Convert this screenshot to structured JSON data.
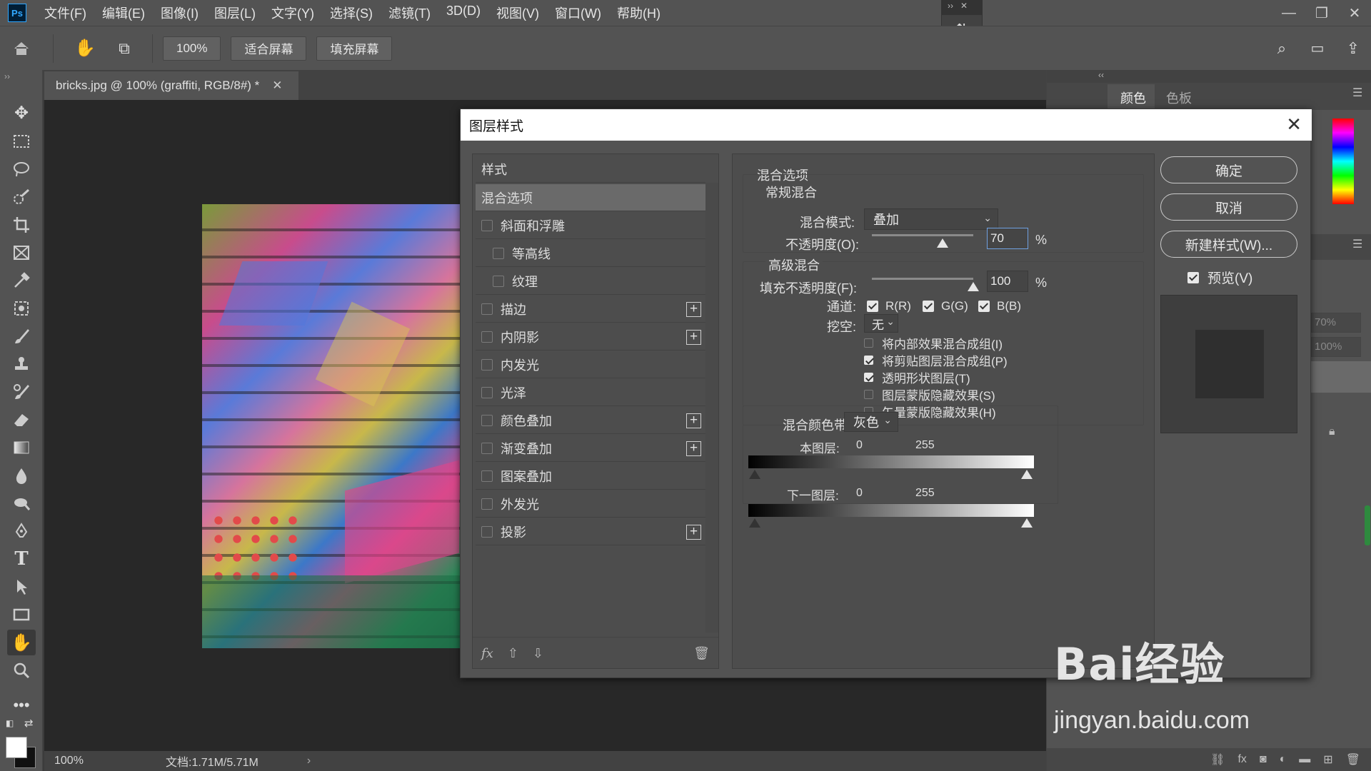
{
  "app": {
    "logo": "Ps"
  },
  "menu": [
    "文件(F)",
    "编辑(E)",
    "图像(I)",
    "图层(L)",
    "文字(Y)",
    "选择(S)",
    "滤镜(T)",
    "3D(D)",
    "视图(V)",
    "窗口(W)",
    "帮助(H)"
  ],
  "options": {
    "zoom": "100%",
    "fit_screen": "适合屏幕",
    "fill_screen": "填充屏幕"
  },
  "document": {
    "tab_title": "bricks.jpg @ 100% (graffiti, RGB/8#) *",
    "status_zoom": "100%",
    "status_doc": "文档:1.71M/5.71M"
  },
  "right_panel": {
    "tabs": [
      "颜色",
      "色板"
    ],
    "opacity_hint": "70%",
    "fill_hint": "100%"
  },
  "dialog": {
    "title": "图层样式",
    "style_list": {
      "header": "样式",
      "items": [
        {
          "label": "混合选项",
          "selected": true
        },
        {
          "label": "斜面和浮雕",
          "checkbox": true
        },
        {
          "label": "等高线",
          "checkbox": true,
          "indent": true
        },
        {
          "label": "纹理",
          "checkbox": true,
          "indent": true
        },
        {
          "label": "描边",
          "checkbox": true,
          "plus": true
        },
        {
          "label": "内阴影",
          "checkbox": true,
          "plus": true
        },
        {
          "label": "内发光",
          "checkbox": true
        },
        {
          "label": "光泽",
          "checkbox": true
        },
        {
          "label": "颜色叠加",
          "checkbox": true,
          "plus": true
        },
        {
          "label": "渐变叠加",
          "checkbox": true,
          "plus": true
        },
        {
          "label": "图案叠加",
          "checkbox": true
        },
        {
          "label": "外发光",
          "checkbox": true
        },
        {
          "label": "投影",
          "checkbox": true,
          "plus": true
        }
      ]
    },
    "blend_options": {
      "section_title": "混合选项",
      "general": {
        "title": "常规混合",
        "mode_label": "混合模式:",
        "mode_value": "叠加",
        "opacity_label": "不透明度(O):",
        "opacity_value": "70",
        "percent": "%",
        "opacity_fraction": 0.7
      },
      "advanced": {
        "title": "高级混合",
        "fill_label": "填充不透明度(F):",
        "fill_value": "100",
        "fill_fraction": 1.0,
        "percent": "%",
        "channels_label": "通道:",
        "channels": [
          "R(R)",
          "G(G)",
          "B(B)"
        ],
        "knockout_label": "挖空:",
        "knockout_value": "无",
        "options": [
          {
            "label": "将内部效果混合成组(I)",
            "checked": false
          },
          {
            "label": "将剪贴图层混合成组(P)",
            "checked": true
          },
          {
            "label": "透明形状图层(T)",
            "checked": true
          },
          {
            "label": "图层蒙版隐藏效果(S)",
            "checked": false
          },
          {
            "label": "矢量蒙版隐藏效果(H)",
            "checked": false
          }
        ]
      },
      "blend_if": {
        "label": "混合颜色带:",
        "value": "灰色",
        "this_layer_label": "本图层:",
        "under_layer_label": "下一图层:",
        "min": "0",
        "max": "255"
      }
    },
    "buttons": {
      "ok": "确定",
      "cancel": "取消",
      "new_style": "新建样式(W)...",
      "preview": "预览(V)"
    }
  },
  "watermark": {
    "brand": "Bai经验",
    "url": "jingyan.baidu.com"
  }
}
